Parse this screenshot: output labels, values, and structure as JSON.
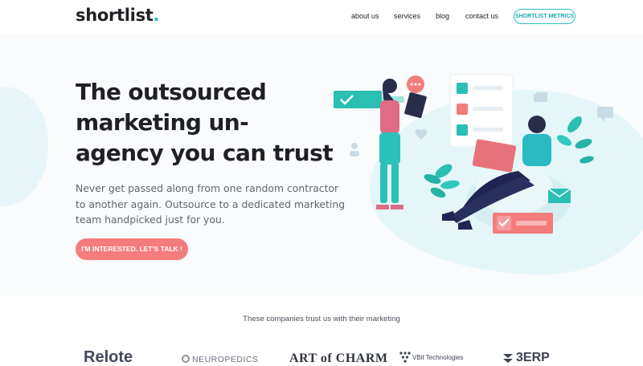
{
  "header": {
    "logo_text": "shortlist",
    "logo_dot": ".",
    "nav": [
      "about us",
      "services",
      "blog",
      "contact us"
    ],
    "metrics_button": "SHORTLIST METRICS"
  },
  "hero": {
    "headline": "The outsourced marketing un-agency you can trust",
    "subtext": "Never get passed along from one random contractor to another again. Outsource to a dedicated marketing team handpicked just for you.",
    "cta": "I'M INTERESTED. LET'S TALK !"
  },
  "trust": {
    "text": "These companies trust us with their marketing",
    "brands": [
      "Relote",
      "NEUROPEDICS",
      "ART of CHARM",
      "VBit Technologies",
      "3ERP"
    ]
  },
  "colors": {
    "accent": "#26c1c4",
    "cta": "#f47c7c",
    "heading": "#1f2024",
    "body": "#5d6672"
  }
}
